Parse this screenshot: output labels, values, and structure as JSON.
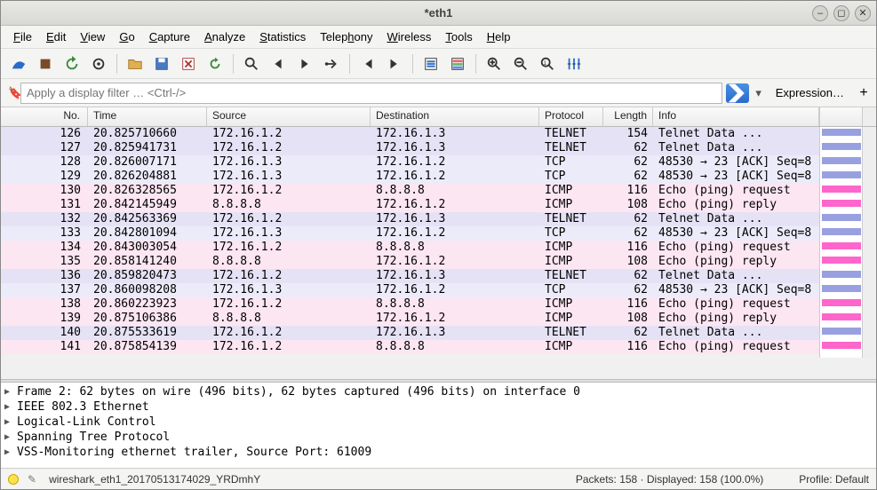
{
  "window": {
    "title": "*eth1"
  },
  "menu": [
    {
      "label": "File",
      "m": 0
    },
    {
      "label": "Edit",
      "m": 0
    },
    {
      "label": "View",
      "m": 0
    },
    {
      "label": "Go",
      "m": 0
    },
    {
      "label": "Capture",
      "m": 0
    },
    {
      "label": "Analyze",
      "m": 0
    },
    {
      "label": "Statistics",
      "m": 0
    },
    {
      "label": "Telephony",
      "m": 5
    },
    {
      "label": "Wireless",
      "m": 0
    },
    {
      "label": "Tools",
      "m": 0
    },
    {
      "label": "Help",
      "m": 0
    }
  ],
  "toolbar_icons": [
    "shark-fin",
    "stop",
    "restart",
    "options",
    "sep",
    "open",
    "save",
    "close",
    "reload",
    "sep",
    "find",
    "prev",
    "next",
    "goto",
    "sep",
    "first",
    "last",
    "sep",
    "autoscroll",
    "colorize",
    "sep",
    "zoom-in",
    "zoom-out",
    "zoom-reset",
    "resize-cols"
  ],
  "filter": {
    "placeholder": "Apply a display filter … <Ctrl-/>",
    "expression_label": "Expression…"
  },
  "columns": {
    "no": "No.",
    "time": "Time",
    "source": "Source",
    "destination": "Destination",
    "protocol": "Protocol",
    "length": "Length",
    "info": "Info"
  },
  "packets": [
    {
      "no": 126,
      "time": "20.825710660",
      "src": "172.16.1.2",
      "dst": "172.16.1.3",
      "proto": "TELNET",
      "len": 154,
      "info": "Telnet Data ...",
      "cls": "telnet"
    },
    {
      "no": 127,
      "time": "20.825941731",
      "src": "172.16.1.2",
      "dst": "172.16.1.3",
      "proto": "TELNET",
      "len": 62,
      "info": "Telnet Data ...",
      "cls": "telnet"
    },
    {
      "no": 128,
      "time": "20.826007171",
      "src": "172.16.1.3",
      "dst": "172.16.1.2",
      "proto": "TCP",
      "len": 62,
      "info": "48530 → 23 [ACK] Seq=8",
      "cls": "tcp"
    },
    {
      "no": 129,
      "time": "20.826204881",
      "src": "172.16.1.3",
      "dst": "172.16.1.2",
      "proto": "TCP",
      "len": 62,
      "info": "48530 → 23 [ACK] Seq=8",
      "cls": "tcp"
    },
    {
      "no": 130,
      "time": "20.826328565",
      "src": "172.16.1.2",
      "dst": "8.8.8.8",
      "proto": "ICMP",
      "len": 116,
      "info": "Echo (ping) request  ",
      "cls": "icmp"
    },
    {
      "no": 131,
      "time": "20.842145949",
      "src": "8.8.8.8",
      "dst": "172.16.1.2",
      "proto": "ICMP",
      "len": 108,
      "info": "Echo (ping) reply    ",
      "cls": "icmp"
    },
    {
      "no": 132,
      "time": "20.842563369",
      "src": "172.16.1.2",
      "dst": "172.16.1.3",
      "proto": "TELNET",
      "len": 62,
      "info": "Telnet Data ...",
      "cls": "telnet"
    },
    {
      "no": 133,
      "time": "20.842801094",
      "src": "172.16.1.3",
      "dst": "172.16.1.2",
      "proto": "TCP",
      "len": 62,
      "info": "48530 → 23 [ACK] Seq=8",
      "cls": "tcp"
    },
    {
      "no": 134,
      "time": "20.843003054",
      "src": "172.16.1.2",
      "dst": "8.8.8.8",
      "proto": "ICMP",
      "len": 116,
      "info": "Echo (ping) request  ",
      "cls": "icmp"
    },
    {
      "no": 135,
      "time": "20.858141240",
      "src": "8.8.8.8",
      "dst": "172.16.1.2",
      "proto": "ICMP",
      "len": 108,
      "info": "Echo (ping) reply    ",
      "cls": "icmp"
    },
    {
      "no": 136,
      "time": "20.859820473",
      "src": "172.16.1.2",
      "dst": "172.16.1.3",
      "proto": "TELNET",
      "len": 62,
      "info": "Telnet Data ...",
      "cls": "telnet"
    },
    {
      "no": 137,
      "time": "20.860098208",
      "src": "172.16.1.3",
      "dst": "172.16.1.2",
      "proto": "TCP",
      "len": 62,
      "info": "48530 → 23 [ACK] Seq=8",
      "cls": "tcp"
    },
    {
      "no": 138,
      "time": "20.860223923",
      "src": "172.16.1.2",
      "dst": "8.8.8.8",
      "proto": "ICMP",
      "len": 116,
      "info": "Echo (ping) request  ",
      "cls": "icmp"
    },
    {
      "no": 139,
      "time": "20.875106386",
      "src": "8.8.8.8",
      "dst": "172.16.1.2",
      "proto": "ICMP",
      "len": 108,
      "info": "Echo (ping) reply    ",
      "cls": "icmp"
    },
    {
      "no": 140,
      "time": "20.875533619",
      "src": "172.16.1.2",
      "dst": "172.16.1.3",
      "proto": "TELNET",
      "len": 62,
      "info": "Telnet Data ...",
      "cls": "telnet"
    },
    {
      "no": 141,
      "time": "20.875854139",
      "src": "172.16.1.2",
      "dst": "8.8.8.8",
      "proto": "ICMP",
      "len": 116,
      "info": "Echo (ping) request  ",
      "cls": "icmp"
    }
  ],
  "details": [
    "Frame 2: 62 bytes on wire (496 bits), 62 bytes captured (496 bits) on interface 0",
    "IEEE 802.3 Ethernet",
    "Logical-Link Control",
    "Spanning Tree Protocol",
    "VSS-Monitoring ethernet trailer, Source Port: 61009"
  ],
  "status": {
    "capture_file": "wireshark_eth1_20170513174029_YRDmhY",
    "packets": "Packets: 158 · Displayed: 158 (100.0%)",
    "profile": "Profile: Default"
  }
}
